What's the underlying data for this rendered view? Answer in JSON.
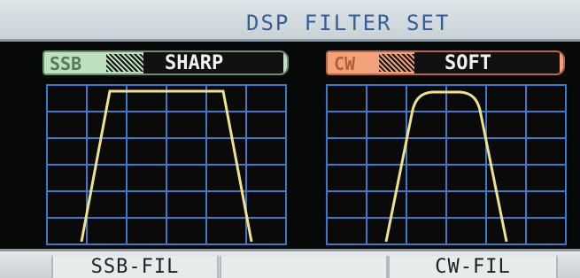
{
  "screen": {
    "title": "DSP FILTER SET"
  },
  "filters": [
    {
      "mode": "SSB",
      "value": "SHARP"
    },
    {
      "mode": "CW",
      "value": "SOFT"
    }
  ],
  "softkeys": [
    "SSB-FIL",
    "",
    "CW-FIL"
  ],
  "colors": {
    "title_text": "#355f98",
    "grid_line": "#3f78c6",
    "curve": "#efe28f",
    "ssb_tag": "#bfe0bf",
    "cw_tag": "#f1a27b"
  }
}
